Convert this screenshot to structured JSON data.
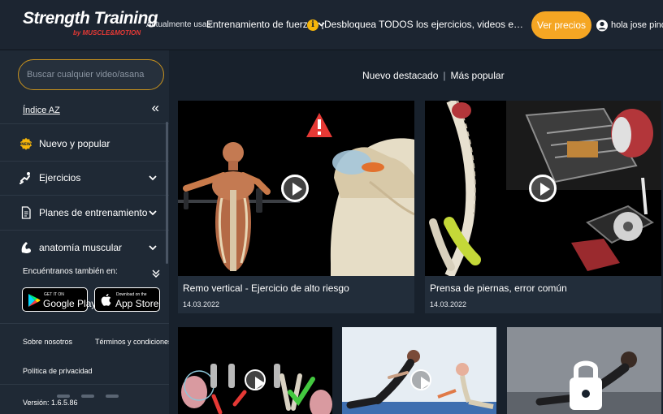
{
  "header": {
    "logo_text": "Strength Training",
    "logo_sub": "by MUSCLE&MOTION",
    "current_label": "Actualmente usas:",
    "current_value": "Entrenamiento de fuerza",
    "promo_text": "¡Desbloquea TODOS los ejercicios, videos educativos y ent…",
    "prices_button": "Ver precios",
    "user_greeting": "hola jose pino",
    "accent_color": "#f5a623"
  },
  "sidebar": {
    "search_placeholder": "Buscar cualquier video/asana",
    "az_link": "Índice AZ",
    "items": [
      {
        "label": "Nuevo y popular",
        "icon": "badge-new-icon"
      },
      {
        "label": "Ejercicios",
        "icon": "exercise-icon"
      },
      {
        "label": "Planes de entrenamiento",
        "icon": "document-icon"
      },
      {
        "label": "anatomía muscular",
        "icon": "muscle-icon"
      }
    ],
    "find_us_label": "Encuéntranos también en:",
    "google_play": {
      "small": "GET IT ON",
      "big": "Google Play"
    },
    "app_store": {
      "small": "Download on the",
      "big": "App Store"
    },
    "about_link": "Sobre nosotros",
    "terms_link": "Términos y condiciones",
    "privacy_link": "Política de privacidad",
    "version": "Versión: 1.6.5.86"
  },
  "main": {
    "tab_featured": "Nuevo destacado",
    "tab_separator": "|",
    "tab_popular": "Más popular",
    "cards": [
      {
        "title": "Remo vertical - Ejercicio de alto riesgo",
        "date": "14.03.2022"
      },
      {
        "title": "Prensa de piernas, error común",
        "date": "14.03.2022"
      }
    ]
  }
}
